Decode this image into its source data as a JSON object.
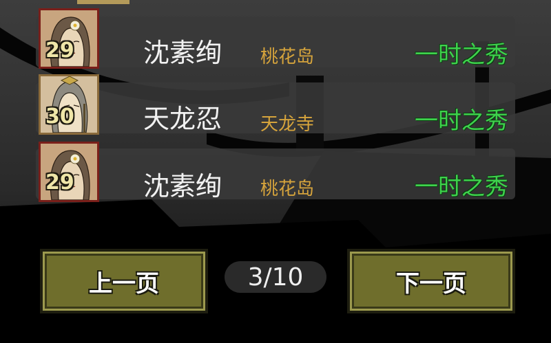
{
  "rows": [
    {
      "level": "29",
      "name": "沈素绚",
      "sect": "桃花岛",
      "title": "一时之秀",
      "portrait": "female-portrait-icon"
    },
    {
      "level": "30",
      "name": "天龙忍",
      "sect": "天龙寺",
      "title": "一时之秀",
      "portrait": "male-portrait-icon"
    },
    {
      "level": "29",
      "name": "沈素绚",
      "sect": "桃花岛",
      "title": "一时之秀",
      "portrait": "female-portrait-icon"
    }
  ],
  "pagination": {
    "prev_label": "上一页",
    "next_label": "下一页",
    "indicator": "3/10"
  },
  "colors": {
    "sect": "#d6a43c",
    "title": "#3fd14d",
    "button": "#6f6e2c",
    "portrait_border": "#7a1f1a"
  }
}
